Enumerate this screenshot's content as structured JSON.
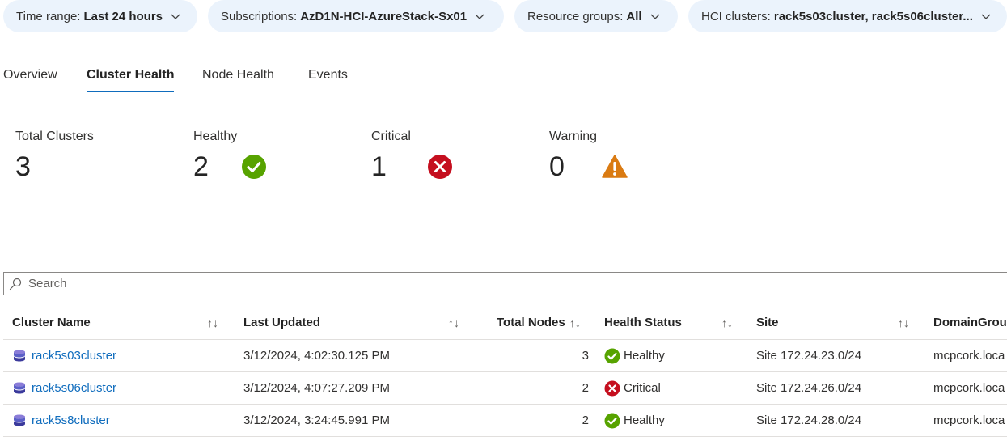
{
  "filters": {
    "time_range": {
      "label": "Time range:",
      "value": "Last 24 hours"
    },
    "subscriptions": {
      "label": "Subscriptions:",
      "value": "AzD1N-HCI-AzureStack-Sx01"
    },
    "resource_groups": {
      "label": "Resource groups:",
      "value": "All"
    },
    "hci_clusters": {
      "label": "HCI clusters:",
      "value": "rack5s03cluster, rack5s06cluster..."
    }
  },
  "tabs": [
    "Overview",
    "Cluster Health",
    "Node Health",
    "Events"
  ],
  "active_tab": "Cluster Health",
  "summary": {
    "total": {
      "label": "Total Clusters",
      "value": "3"
    },
    "healthy": {
      "label": "Healthy",
      "value": "2",
      "icon": "check-circle-icon",
      "color": "#57a300"
    },
    "critical": {
      "label": "Critical",
      "value": "1",
      "icon": "error-circle-icon",
      "color": "#c50f1f"
    },
    "warning": {
      "label": "Warning",
      "value": "0",
      "icon": "warning-triangle-icon",
      "color": "#da7b12"
    }
  },
  "search": {
    "placeholder": "Search"
  },
  "table": {
    "columns": [
      "Cluster Name",
      "Last Updated",
      "Total Nodes",
      "Health Status",
      "Site",
      "DomainGrou"
    ],
    "rows": [
      {
        "name": "rack5s03cluster",
        "updated": "3/12/2024, 4:02:30.125 PM",
        "nodes": "3",
        "status": "Healthy",
        "site": "Site 172.24.23.0/24",
        "domain": "mcpcork.loca"
      },
      {
        "name": "rack5s06cluster",
        "updated": "3/12/2024, 4:07:27.209 PM",
        "nodes": "2",
        "status": "Critical",
        "site": "Site 172.24.26.0/24",
        "domain": "mcpcork.loca"
      },
      {
        "name": "rack5s8cluster",
        "updated": "3/12/2024, 3:24:45.991 PM",
        "nodes": "2",
        "status": "Healthy",
        "site": "Site 172.24.28.0/24",
        "domain": "mcpcork.loca"
      }
    ]
  },
  "colors": {
    "accent": "#0f6cbd",
    "pill_bg": "#ebf3fc",
    "healthy": "#57a300",
    "critical": "#c50f1f",
    "warning": "#da7b12"
  }
}
